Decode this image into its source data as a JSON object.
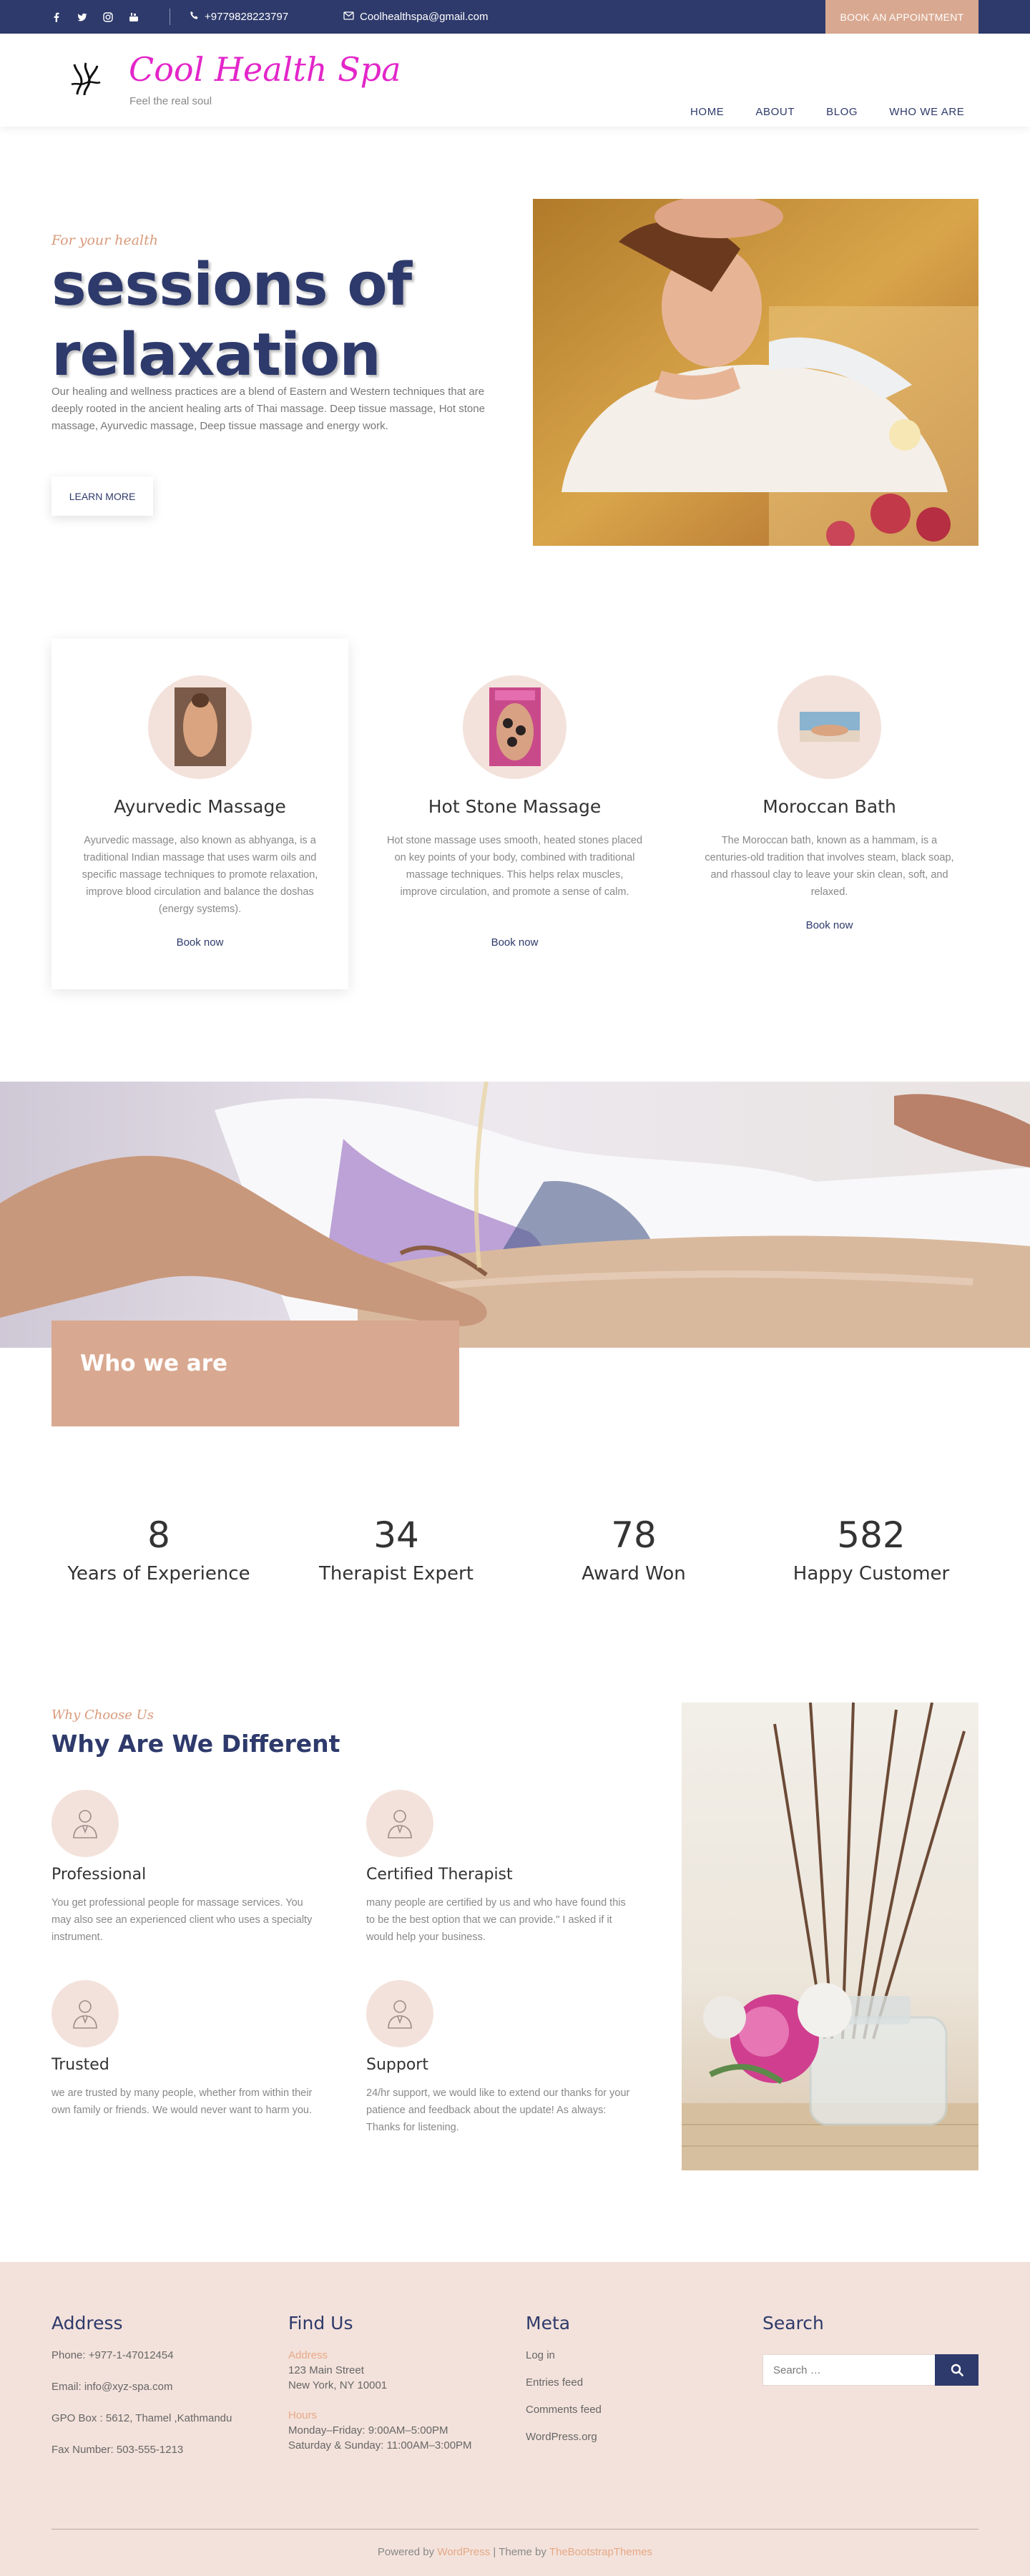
{
  "topbar": {
    "social_icons": [
      "facebook-icon",
      "twitter-icon",
      "instagram-icon",
      "youtube-icon"
    ],
    "phone": "+9779828223797",
    "email": "Coolhealthspa@gmail.com",
    "book_label": "BOOK AN APPOINTMENT"
  },
  "header": {
    "brand": "Cool Health Spa",
    "tagline": "Feel the real soul",
    "nav": [
      "HOME",
      "ABOUT",
      "BLOG",
      "WHO WE ARE"
    ]
  },
  "hero": {
    "kicker": "For your health",
    "title_line1": "sessions of",
    "title_line2": "relaxation",
    "text": "Our healing and wellness practices are a blend of Eastern and Western techniques that are deeply rooted in the ancient healing arts of Thai massage. Deep tissue massage, Hot stone massage, Ayurvedic massage, Deep tissue massage and energy work.",
    "button": "LEARN MORE"
  },
  "services": [
    {
      "title": "Ayurvedic Massage",
      "text": "Ayurvedic massage, also known as abhyanga, is a traditional Indian massage that uses warm oils and specific massage techniques to promote relaxation, improve blood circulation and balance the doshas (energy systems).",
      "link": "Book now"
    },
    {
      "title": "Hot Stone Massage",
      "text": "Hot stone massage uses smooth, heated stones placed on key points of your body, combined with traditional massage techniques. This helps relax muscles, improve circulation, and promote a sense of calm.",
      "link": "Book now"
    },
    {
      "title": "Moroccan Bath",
      "text": "The Moroccan bath, known as a hammam, is a centuries-old tradition that involves steam, black soap, and rhassoul clay to leave your skin clean, soft, and relaxed.",
      "link": "Book now"
    }
  ],
  "who_we_are": {
    "label": "Who we are"
  },
  "stats": [
    {
      "value": "8",
      "label": "Years of Experience"
    },
    {
      "value": "34",
      "label": "Therapist Expert"
    },
    {
      "value": "78",
      "label": "Award Won"
    },
    {
      "value": "582",
      "label": "Happy Customer"
    }
  ],
  "why": {
    "kicker": "Why Choose Us",
    "title": "Why Are We Different",
    "features": [
      {
        "title": "Professional",
        "text": "You get professional people for massage services. You may also see an experienced client who uses a specialty instrument."
      },
      {
        "title": "Certified Therapist",
        "text": "many people are certified by us and who have found this to be the best option that we can provide.\" I asked if it would help your business."
      },
      {
        "title": "Trusted",
        "text": "we are trusted by many people, whether from within their own family or friends. We would never want to harm you."
      },
      {
        "title": "Support",
        "text": "24/hr support, we would like to extend our thanks for your patience and feedback about the update! As always: Thanks for listening."
      }
    ]
  },
  "footer": {
    "address": {
      "title": "Address",
      "lines": [
        "Phone: +977-1-47012454",
        "Email: info@xyz-spa.com",
        "GPO Box : 5612, Thamel ,Kathmandu",
        "Fax Number: 503-555-1213"
      ]
    },
    "find_us": {
      "title": "Find Us",
      "address_label": "Address",
      "address_lines": [
        "123 Main Street",
        "New York, NY 10001"
      ],
      "hours_label": "Hours",
      "hours_lines": [
        "Monday–Friday: 9:00AM–5:00PM",
        "Saturday & Sunday: 11:00AM–3:00PM"
      ]
    },
    "meta": {
      "title": "Meta",
      "links": [
        "Log in",
        "Entries feed",
        "Comments feed",
        "WordPress.org"
      ]
    },
    "search": {
      "title": "Search",
      "placeholder": "Search …"
    },
    "copyright": {
      "prefix": "Powered by",
      "wp": "WordPress",
      "middle": "| Theme by",
      "theme": "TheBootstrapThemes"
    }
  },
  "colors": {
    "navy": "#2e3a6b",
    "accent_peach": "#d9a890",
    "brand_pink": "#e326c9",
    "footer_bg": "#f3e2db"
  }
}
